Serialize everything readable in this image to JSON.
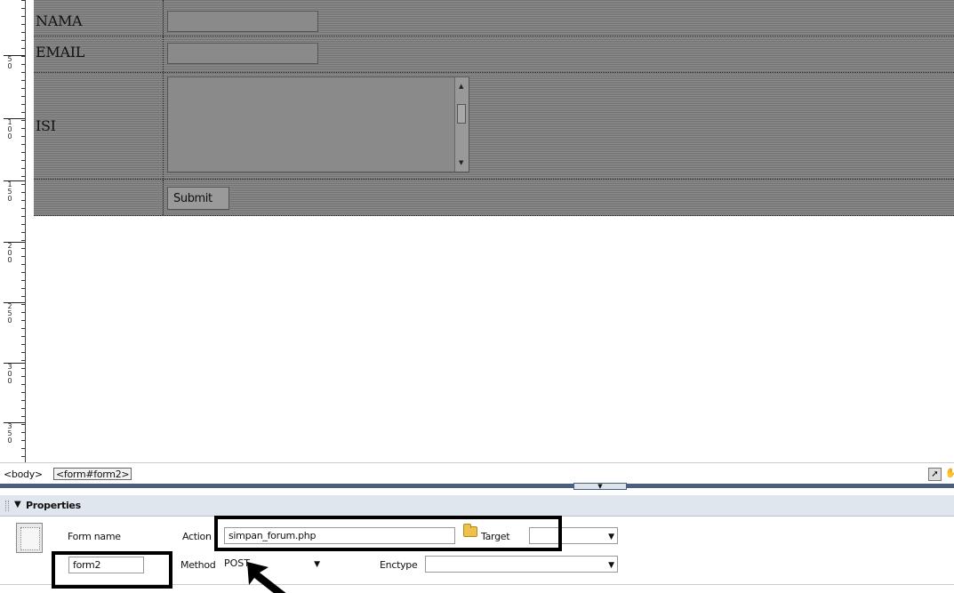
{
  "form_table": {
    "rows": [
      {
        "label": "NAMA"
      },
      {
        "label": "EMAIL"
      },
      {
        "label": "ISI"
      }
    ],
    "submit_label": "Submit"
  },
  "ruler": {
    "labels": [
      "5\n0",
      "1\n0\n0",
      "1\n5\n0",
      "2\n0\n0",
      "2\n5\n0",
      "3\n0\n0",
      "3\n5\n0"
    ]
  },
  "tag_selector": {
    "body_tag": "<body>",
    "form_tag": "<form#form2>"
  },
  "properties": {
    "title": "Properties",
    "form_name_label": "Form name",
    "form_name_value": "form2",
    "action_label": "Action",
    "action_value": "simpan_forum.php",
    "target_label": "Target",
    "target_value": "",
    "method_label": "Method",
    "method_value": "POST",
    "enctype_label": "Enctype",
    "enctype_value": ""
  },
  "icons": {
    "panel_toggle": "triangle-down-icon",
    "folder": "folder-icon",
    "select_tool": "pointer-icon",
    "hand_tool": "hand-icon",
    "annotation_arrow": "arrow-icon"
  },
  "colors": {
    "form_area": "#8c8c8c",
    "panel_header": "#dfe6ee",
    "panel_strip": "#4a5f80",
    "annotation": "#000000"
  }
}
